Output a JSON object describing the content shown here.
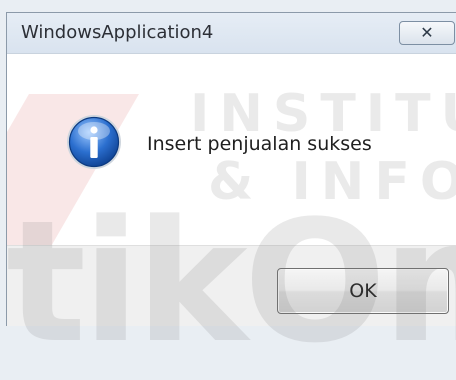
{
  "window": {
    "title": "WindowsApplication4",
    "close_label": "✕"
  },
  "dialog": {
    "icon": "info-icon",
    "message": "Insert penjualan sukses",
    "ok_label": "OK"
  },
  "watermark": {
    "line1": "INSTITU",
    "line2": "& INFOR",
    "big": "tikOm"
  },
  "colors": {
    "info_blue": "#2b6fcf",
    "watermark_red": "#c81414"
  }
}
